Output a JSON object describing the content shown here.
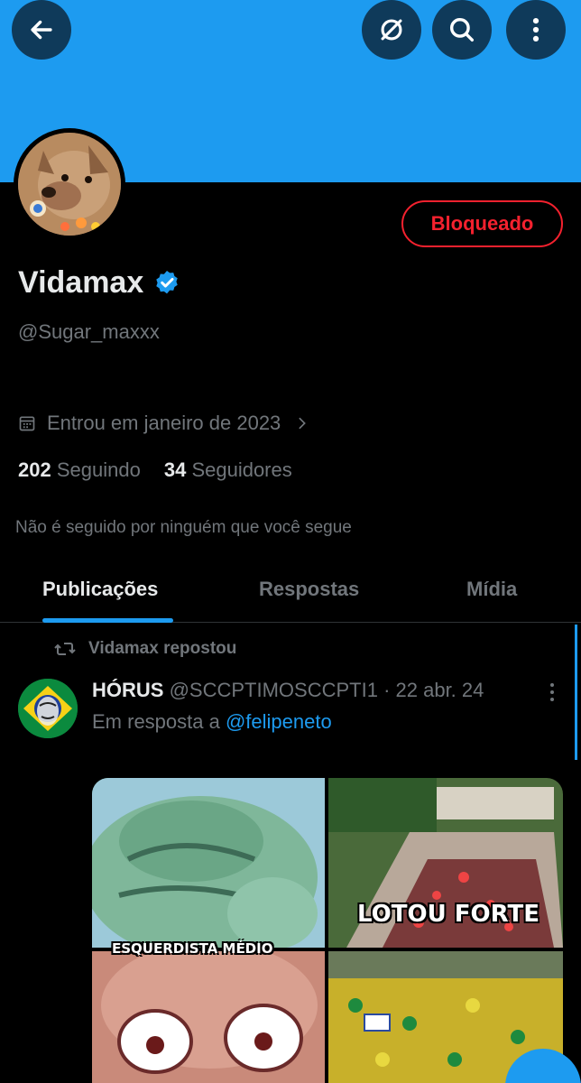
{
  "header": {
    "back_icon": "arrow-left-icon",
    "grok_icon": "grok-slash-icon",
    "search_icon": "search-icon",
    "more_icon": "more-vertical-icon",
    "banner_color": "#1d9bf0"
  },
  "profile": {
    "display_name": "Vidamax",
    "handle": "@Sugar_maxxx",
    "verified": true,
    "blocked_label": "Bloqueado",
    "joined": "Entrou em janeiro de 2023",
    "following_count": "202",
    "following_label": "Seguindo",
    "followers_count": "34",
    "followers_label": "Seguidores",
    "not_followed_text": "Não é seguido por ninguém que você segue"
  },
  "tabs": [
    {
      "label": "Publicações",
      "active": true
    },
    {
      "label": "Respostas",
      "active": false
    },
    {
      "label": "Mídia",
      "active": false
    }
  ],
  "post": {
    "repost_text": "Vidamax repostou",
    "author_name": "HÓRUS",
    "author_handle": "@SCCPTIMOSCCPTI1",
    "separator": "·",
    "date": "22 abr. 24",
    "reply_prefix": "Em resposta a",
    "reply_handle": "@felipeneto",
    "media": {
      "label_left": "ESQUERDISTA MÉDIO",
      "label_right": "LOTOU FORTE"
    }
  },
  "colors": {
    "accent": "#1d9bf0",
    "blocked": "#f4212e",
    "muted": "#71767b",
    "text": "#e7e9ea",
    "background": "#000000"
  }
}
